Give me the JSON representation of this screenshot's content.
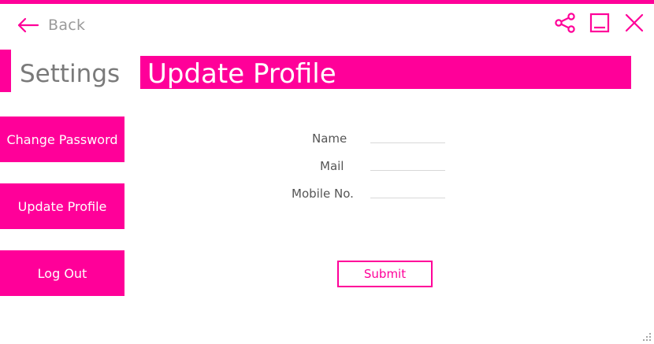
{
  "theme": {
    "accent": "#ff0099",
    "muted_text": "#9a9a9a",
    "body_text": "#555555"
  },
  "topbar": {
    "back_label": "Back",
    "back_icon": "arrow-left-icon",
    "controls": [
      "share-icon",
      "minimize-icon",
      "close-icon"
    ]
  },
  "sidebar": {
    "title": "Settings",
    "items": [
      {
        "label": "Change Password"
      },
      {
        "label": "Update Profile"
      },
      {
        "label": "Log Out"
      }
    ]
  },
  "main": {
    "header": "Update Profile",
    "form": {
      "fields": [
        {
          "label": "Name",
          "value": ""
        },
        {
          "label": "Mail",
          "value": ""
        },
        {
          "label": "Mobile No.",
          "value": ""
        }
      ],
      "submit_label": "Submit"
    }
  }
}
